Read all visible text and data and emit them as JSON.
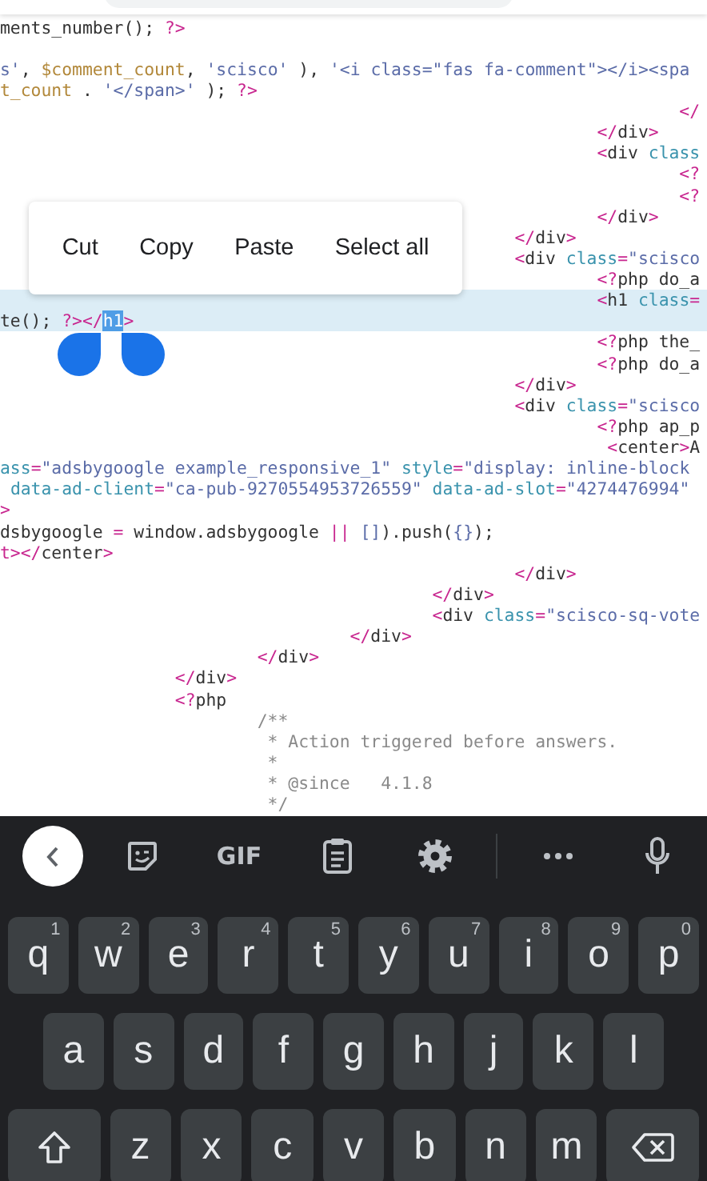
{
  "editor": {
    "lines": [
      {
        "current": false,
        "segs": [
          {
            "kind": "plain",
            "t": "ments_number(); "
          },
          {
            "kind": "tag",
            "t": "?>"
          }
        ]
      },
      {
        "current": false
      },
      {
        "current": false,
        "segs": [
          {
            "kind": "str",
            "t": "s'"
          },
          {
            "kind": "plain",
            "t": ", "
          },
          {
            "kind": "var",
            "t": "$comment_count"
          },
          {
            "kind": "plain",
            "t": ", "
          },
          {
            "kind": "str",
            "t": "'scisco'"
          },
          {
            "kind": "plain",
            "t": " ), "
          },
          {
            "kind": "str",
            "t": "'<i class=\"fas fa-comment\"></i><spa"
          }
        ]
      },
      {
        "current": false,
        "segs": [
          {
            "kind": "var",
            "t": "t_count"
          },
          {
            "kind": "plain",
            "t": " . "
          },
          {
            "kind": "str",
            "t": "'</span>'"
          },
          {
            "kind": "plain",
            "t": " ); "
          },
          {
            "kind": "tag",
            "t": "?>"
          }
        ]
      },
      {
        "current": false,
        "segs": [
          {
            "kind": "tag",
            "t": "                                                                  </"
          }
        ]
      },
      {
        "current": false,
        "segs": [
          {
            "kind": "tag",
            "t": "                                                          </"
          },
          {
            "kind": "plain",
            "t": "div"
          },
          {
            "kind": "tag",
            "t": ">"
          }
        ]
      },
      {
        "current": false,
        "segs": [
          {
            "kind": "tag",
            "t": "                                                          <"
          },
          {
            "kind": "plain",
            "t": "div "
          },
          {
            "kind": "attr",
            "t": "class"
          }
        ]
      },
      {
        "current": false,
        "segs": [
          {
            "kind": "tag",
            "t": "                                                                  <?"
          }
        ]
      },
      {
        "current": false,
        "segs": [
          {
            "kind": "tag",
            "t": "                                                                  <?"
          }
        ]
      },
      {
        "current": false,
        "segs": [
          {
            "kind": "tag",
            "t": "                                                          </"
          },
          {
            "kind": "plain",
            "t": "div"
          },
          {
            "kind": "tag",
            "t": ">"
          }
        ]
      },
      {
        "current": false,
        "segs": [
          {
            "kind": "tag",
            "t": "                                                  </"
          },
          {
            "kind": "plain",
            "t": "div"
          },
          {
            "kind": "tag",
            "t": ">"
          }
        ]
      },
      {
        "current": false,
        "segs": [
          {
            "kind": "tag",
            "t": "                                                  <"
          },
          {
            "kind": "plain",
            "t": "div "
          },
          {
            "kind": "attr",
            "t": "class"
          },
          {
            "kind": "tag",
            "t": "="
          },
          {
            "kind": "str",
            "t": "\"scisco"
          }
        ]
      },
      {
        "current": false,
        "segs": [
          {
            "kind": "tag",
            "t": "                                                          <?"
          },
          {
            "kind": "plain",
            "t": "php do_a"
          }
        ]
      },
      {
        "current": true,
        "segs": [
          {
            "kind": "tag",
            "t": "                                                          <"
          },
          {
            "kind": "plain",
            "t": "h1 "
          },
          {
            "kind": "attr",
            "t": "class"
          },
          {
            "kind": "tag",
            "t": "="
          }
        ]
      },
      {
        "current": true,
        "segs": [
          {
            "kind": "plain",
            "t": "te(); "
          },
          {
            "kind": "tag",
            "t": "?></"
          },
          {
            "kind": "sel",
            "t": "h1"
          },
          {
            "kind": "tag",
            "t": ">"
          }
        ]
      },
      {
        "current": false,
        "segs": [
          {
            "kind": "tag",
            "t": "                                                          <?"
          },
          {
            "kind": "plain",
            "t": "php the_"
          }
        ]
      },
      {
        "current": false,
        "segs": [
          {
            "kind": "tag",
            "t": "                                                          <?"
          },
          {
            "kind": "plain",
            "t": "php do_a"
          }
        ]
      },
      {
        "current": false,
        "segs": [
          {
            "kind": "tag",
            "t": "                                                  </"
          },
          {
            "kind": "plain",
            "t": "div"
          },
          {
            "kind": "tag",
            "t": ">"
          }
        ]
      },
      {
        "current": false,
        "segs": [
          {
            "kind": "tag",
            "t": "                                                  <"
          },
          {
            "kind": "plain",
            "t": "div "
          },
          {
            "kind": "attr",
            "t": "class"
          },
          {
            "kind": "tag",
            "t": "="
          },
          {
            "kind": "str",
            "t": "\"scisco"
          }
        ]
      },
      {
        "current": false,
        "segs": [
          {
            "kind": "tag",
            "t": "                                                          <?"
          },
          {
            "kind": "plain",
            "t": "php ap_p"
          }
        ]
      },
      {
        "current": false,
        "segs": [
          {
            "kind": "tag",
            "t": "                                                           <"
          },
          {
            "kind": "plain",
            "t": "center"
          },
          {
            "kind": "tag",
            "t": ">"
          },
          {
            "kind": "plain",
            "t": "A"
          }
        ]
      },
      {
        "current": false,
        "segs": [
          {
            "kind": "attr",
            "t": "ass"
          },
          {
            "kind": "tag",
            "t": "="
          },
          {
            "kind": "str",
            "t": "\"adsbygoogle example_responsive_1\" "
          },
          {
            "kind": "attr",
            "t": "style"
          },
          {
            "kind": "tag",
            "t": "="
          },
          {
            "kind": "str",
            "t": "\"display: inline-block"
          }
        ]
      },
      {
        "current": false,
        "segs": [
          {
            "kind": "attr",
            "t": " data-ad-client"
          },
          {
            "kind": "tag",
            "t": "="
          },
          {
            "kind": "str",
            "t": "\"ca-pub-9270554953726559\" "
          },
          {
            "kind": "attr",
            "t": "data-ad-slot"
          },
          {
            "kind": "tag",
            "t": "="
          },
          {
            "kind": "str",
            "t": "\"4274476994\""
          }
        ]
      },
      {
        "current": false,
        "segs": [
          {
            "kind": "tag",
            "t": ">"
          }
        ]
      },
      {
        "current": false,
        "segs": [
          {
            "kind": "plain",
            "t": "dsbygoogle "
          },
          {
            "kind": "tag",
            "t": "="
          },
          {
            "kind": "plain",
            "t": " window.adsbygoogle "
          },
          {
            "kind": "tag",
            "t": "|| "
          },
          {
            "kind": "str",
            "t": "[]"
          },
          {
            "kind": "plain",
            "t": ").push("
          },
          {
            "kind": "str",
            "t": "{}"
          },
          {
            "kind": "plain",
            "t": ");"
          }
        ]
      },
      {
        "current": false,
        "segs": [
          {
            "kind": "tag",
            "t": "t></"
          },
          {
            "kind": "plain",
            "t": "center"
          },
          {
            "kind": "tag",
            "t": ">"
          }
        ]
      },
      {
        "current": false,
        "segs": [
          {
            "kind": "tag",
            "t": "                                                  </"
          },
          {
            "kind": "plain",
            "t": "div"
          },
          {
            "kind": "tag",
            "t": ">"
          }
        ]
      },
      {
        "current": false,
        "segs": [
          {
            "kind": "tag",
            "t": "                                          </"
          },
          {
            "kind": "plain",
            "t": "div"
          },
          {
            "kind": "tag",
            "t": ">"
          }
        ]
      },
      {
        "current": false,
        "segs": [
          {
            "kind": "tag",
            "t": "                                          <"
          },
          {
            "kind": "plain",
            "t": "div "
          },
          {
            "kind": "attr",
            "t": "class"
          },
          {
            "kind": "tag",
            "t": "="
          },
          {
            "kind": "str",
            "t": "\"scisco-sq-vote"
          }
        ]
      },
      {
        "current": false,
        "segs": [
          {
            "kind": "tag",
            "t": "                                  </"
          },
          {
            "kind": "plain",
            "t": "div"
          },
          {
            "kind": "tag",
            "t": ">"
          }
        ]
      },
      {
        "current": false,
        "segs": [
          {
            "kind": "tag",
            "t": "                         </"
          },
          {
            "kind": "plain",
            "t": "div"
          },
          {
            "kind": "tag",
            "t": ">"
          }
        ]
      },
      {
        "current": false,
        "segs": [
          {
            "kind": "tag",
            "t": "                 </"
          },
          {
            "kind": "plain",
            "t": "div"
          },
          {
            "kind": "tag",
            "t": ">"
          }
        ]
      },
      {
        "current": false,
        "segs": [
          {
            "kind": "tag",
            "t": "                 <?"
          },
          {
            "kind": "plain",
            "t": "php"
          }
        ]
      },
      {
        "current": false,
        "segs": [
          {
            "kind": "cmt",
            "t": "                         /**"
          }
        ]
      },
      {
        "current": false,
        "segs": [
          {
            "kind": "cmt",
            "t": "                          * Action triggered before answers."
          }
        ]
      },
      {
        "current": false,
        "segs": [
          {
            "kind": "cmt",
            "t": "                          *"
          }
        ]
      },
      {
        "current": false,
        "segs": [
          {
            "kind": "cmt",
            "t": "                          * @since   4.1.8"
          }
        ]
      },
      {
        "current": false,
        "segs": [
          {
            "kind": "cmt",
            "t": "                          */"
          }
        ]
      }
    ]
  },
  "context_menu": {
    "items": [
      "Cut",
      "Copy",
      "Paste",
      "Select all"
    ]
  },
  "keyboard": {
    "toolbar": {
      "gif": "GIF"
    },
    "rows": [
      [
        {
          "kind": "letter",
          "label": "q",
          "hint": "1"
        },
        {
          "kind": "letter",
          "label": "w",
          "hint": "2"
        },
        {
          "kind": "letter",
          "label": "e",
          "hint": "3"
        },
        {
          "kind": "letter",
          "label": "r",
          "hint": "4"
        },
        {
          "kind": "letter",
          "label": "t",
          "hint": "5"
        },
        {
          "kind": "letter",
          "label": "y",
          "hint": "6"
        },
        {
          "kind": "letter",
          "label": "u",
          "hint": "7"
        },
        {
          "kind": "letter",
          "label": "i",
          "hint": "8"
        },
        {
          "kind": "letter",
          "label": "o",
          "hint": "9"
        },
        {
          "kind": "letter",
          "label": "p",
          "hint": "0"
        }
      ],
      [
        {
          "kind": "letter",
          "label": "a"
        },
        {
          "kind": "letter",
          "label": "s"
        },
        {
          "kind": "letter",
          "label": "d"
        },
        {
          "kind": "letter",
          "label": "f"
        },
        {
          "kind": "letter",
          "label": "g"
        },
        {
          "kind": "letter",
          "label": "h"
        },
        {
          "kind": "letter",
          "label": "j"
        },
        {
          "kind": "letter",
          "label": "k"
        },
        {
          "kind": "letter",
          "label": "l"
        }
      ],
      [
        {
          "kind": "shift"
        },
        {
          "kind": "letter",
          "label": "z"
        },
        {
          "kind": "letter",
          "label": "x"
        },
        {
          "kind": "letter",
          "label": "c"
        },
        {
          "kind": "letter",
          "label": "v"
        },
        {
          "kind": "letter",
          "label": "b"
        },
        {
          "kind": "letter",
          "label": "n"
        },
        {
          "kind": "letter",
          "label": "m"
        },
        {
          "kind": "backspace"
        }
      ]
    ]
  }
}
